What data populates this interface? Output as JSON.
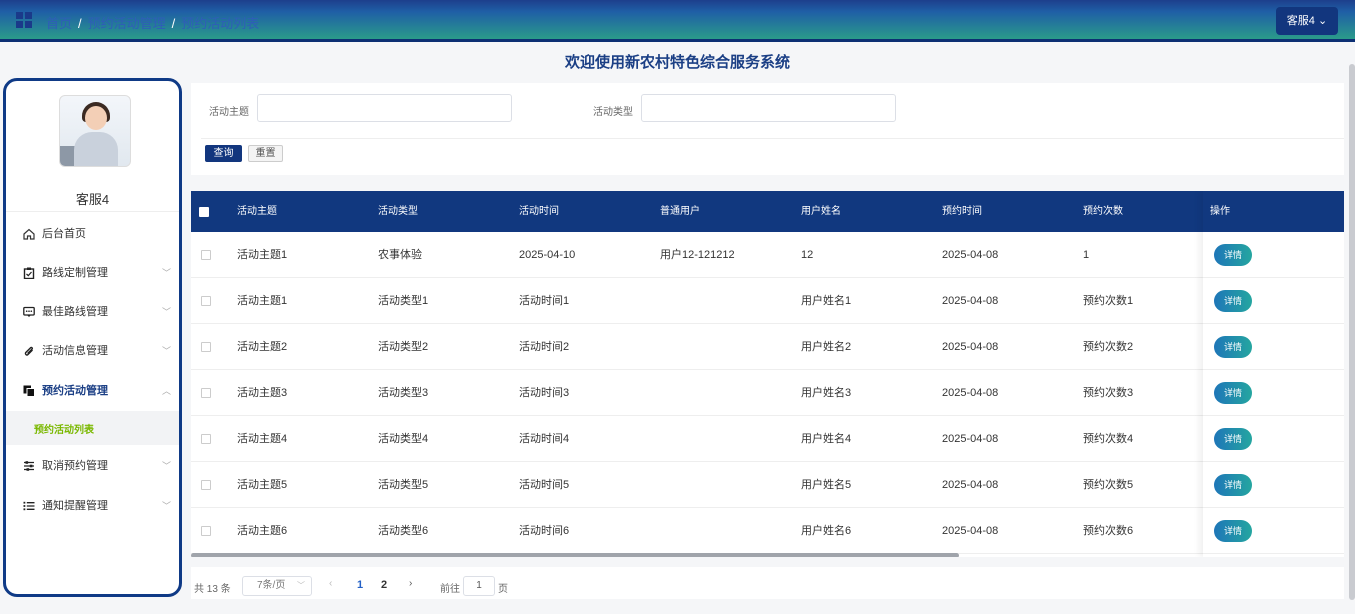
{
  "header": {
    "breadcrumb": [
      "首页",
      "预约活动管理",
      "预约活动列表"
    ],
    "user_button": "客服4",
    "welcome": "欢迎使用新农村特色综合服务系统"
  },
  "sidebar": {
    "username": "客服4",
    "items": [
      {
        "label": "后台首页",
        "icon": "home-icon"
      },
      {
        "label": "路线定制管理",
        "icon": "clipboard-icon"
      },
      {
        "label": "最佳路线管理",
        "icon": "message-icon"
      },
      {
        "label": "活动信息管理",
        "icon": "paperclip-icon"
      },
      {
        "label": "预约活动管理",
        "icon": "copy-icon"
      },
      {
        "label": "取消预约管理",
        "icon": "sliders-icon"
      },
      {
        "label": "通知提醒管理",
        "icon": "list-icon"
      }
    ],
    "active_sub": "预约活动列表"
  },
  "search": {
    "field1_label": "活动主题",
    "field1_value": "",
    "field2_label": "活动类型",
    "field2_value": "",
    "query_label": "查询",
    "reset_label": "重置"
  },
  "table": {
    "headers": [
      "活动主题",
      "活动类型",
      "活动时间",
      "普通用户",
      "用户姓名",
      "预约时间",
      "预约次数",
      "操作"
    ],
    "detail_label": "详情",
    "rows": [
      [
        "活动主题1",
        "农事体验",
        "2025-04-10",
        "用户12-121212",
        "12",
        "2025-04-08",
        "1"
      ],
      [
        "活动主题1",
        "活动类型1",
        "活动时间1",
        "",
        "用户姓名1",
        "2025-04-08",
        "预约次数1"
      ],
      [
        "活动主题2",
        "活动类型2",
        "活动时间2",
        "",
        "用户姓名2",
        "2025-04-08",
        "预约次数2"
      ],
      [
        "活动主题3",
        "活动类型3",
        "活动时间3",
        "",
        "用户姓名3",
        "2025-04-08",
        "预约次数3"
      ],
      [
        "活动主题4",
        "活动类型4",
        "活动时间4",
        "",
        "用户姓名4",
        "2025-04-08",
        "预约次数4"
      ],
      [
        "活动主题5",
        "活动类型5",
        "活动时间5",
        "",
        "用户姓名5",
        "2025-04-08",
        "预约次数5"
      ],
      [
        "活动主题6",
        "活动类型6",
        "活动时间6",
        "",
        "用户姓名6",
        "2025-04-08",
        "预约次数6"
      ]
    ]
  },
  "pagination": {
    "total": "共 13 条",
    "page_size": "7条/页",
    "pages": [
      "1",
      "2"
    ],
    "goto_label": "前往",
    "goto_value": "1",
    "page_unit": "页"
  },
  "colors": {
    "primary": "#11387f",
    "accent_green": "#7ab800",
    "detail_button": "#1e76b8"
  }
}
